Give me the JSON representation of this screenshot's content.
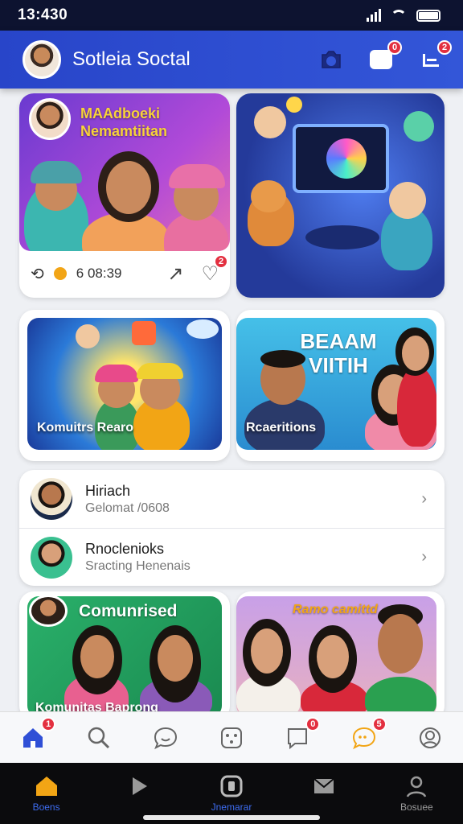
{
  "status": {
    "time": "13:430"
  },
  "header": {
    "title": "Sotleia Soctal",
    "notif_badge": "0",
    "menu_badge": "2"
  },
  "feed": [
    {
      "title": "MAAdboeki Nemamtiitan",
      "stat": "6 08:39",
      "like_badge": "2",
      "label": ""
    },
    {
      "title": "",
      "stat": "",
      "label": ""
    },
    {
      "title": "",
      "label": "Komuitrs Rearo"
    },
    {
      "title": "BEAAM VIITIH",
      "label": "Rcaeritions"
    }
  ],
  "list": [
    {
      "title": "Hiriach",
      "subtitle": "Gelomat /0608"
    },
    {
      "title": "Rnoclenioks",
      "subtitle": "Sracting Henenais"
    }
  ],
  "bottom_cards": [
    {
      "title": "Comunrised",
      "label": "Komunitas Baprong"
    },
    {
      "title": "Ramo camittd",
      "label": ""
    }
  ],
  "secondary_bar": {
    "home_badge": "1",
    "chat_badge": "0",
    "msg_badge": "5"
  },
  "nav": [
    {
      "label": "Boens"
    },
    {
      "label": ""
    },
    {
      "label": "Jnemarar"
    },
    {
      "label": ""
    },
    {
      "label": "Bosuee"
    }
  ],
  "colors": {
    "accent": "#2f4fd6",
    "badge": "#e33040",
    "nav_bg": "#0b0b0d"
  }
}
